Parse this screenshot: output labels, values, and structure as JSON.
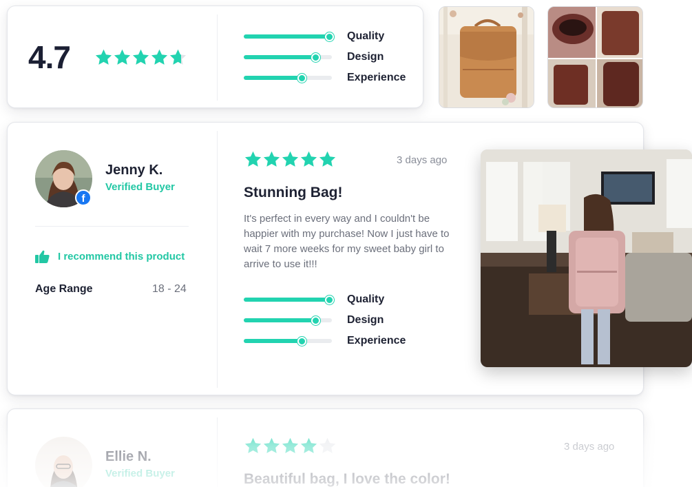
{
  "summary": {
    "rating": "4.7",
    "stars": 4.7,
    "criteria": [
      {
        "label": "Quality",
        "level": 0.97
      },
      {
        "label": "Design",
        "level": 0.82
      },
      {
        "label": "Experience",
        "level": 0.66
      }
    ]
  },
  "review": {
    "reviewer_name": "Jenny K.",
    "verified_label": "Verified Buyer",
    "recommend_label": "I recommend this product",
    "age_label": "Age Range",
    "age_value": "18 - 24",
    "stars": 5,
    "date": "3 days ago",
    "title": "Stunning Bag!",
    "body": "It's perfect in every way and I couldn't be happier with my purchase! Now I just have to wait 7 more weeks for my sweet baby girl to arrive to use it!!!",
    "criteria": [
      {
        "label": "Quality",
        "level": 0.97
      },
      {
        "label": "Design",
        "level": 0.82
      },
      {
        "label": "Experience",
        "level": 0.66
      }
    ]
  },
  "next_review": {
    "reviewer_name": "Ellie N.",
    "verified_label": "Verified Buyer",
    "stars": 4,
    "date": "3 days ago",
    "title": "Beautiful bag, I love the color!"
  },
  "colors": {
    "accent": "#22d3b0",
    "text": "#1e2233",
    "muted": "#6b6f7b",
    "facebook": "#1877f2"
  },
  "icons": [
    "star-icon",
    "thumbs-up-icon",
    "facebook-icon"
  ]
}
